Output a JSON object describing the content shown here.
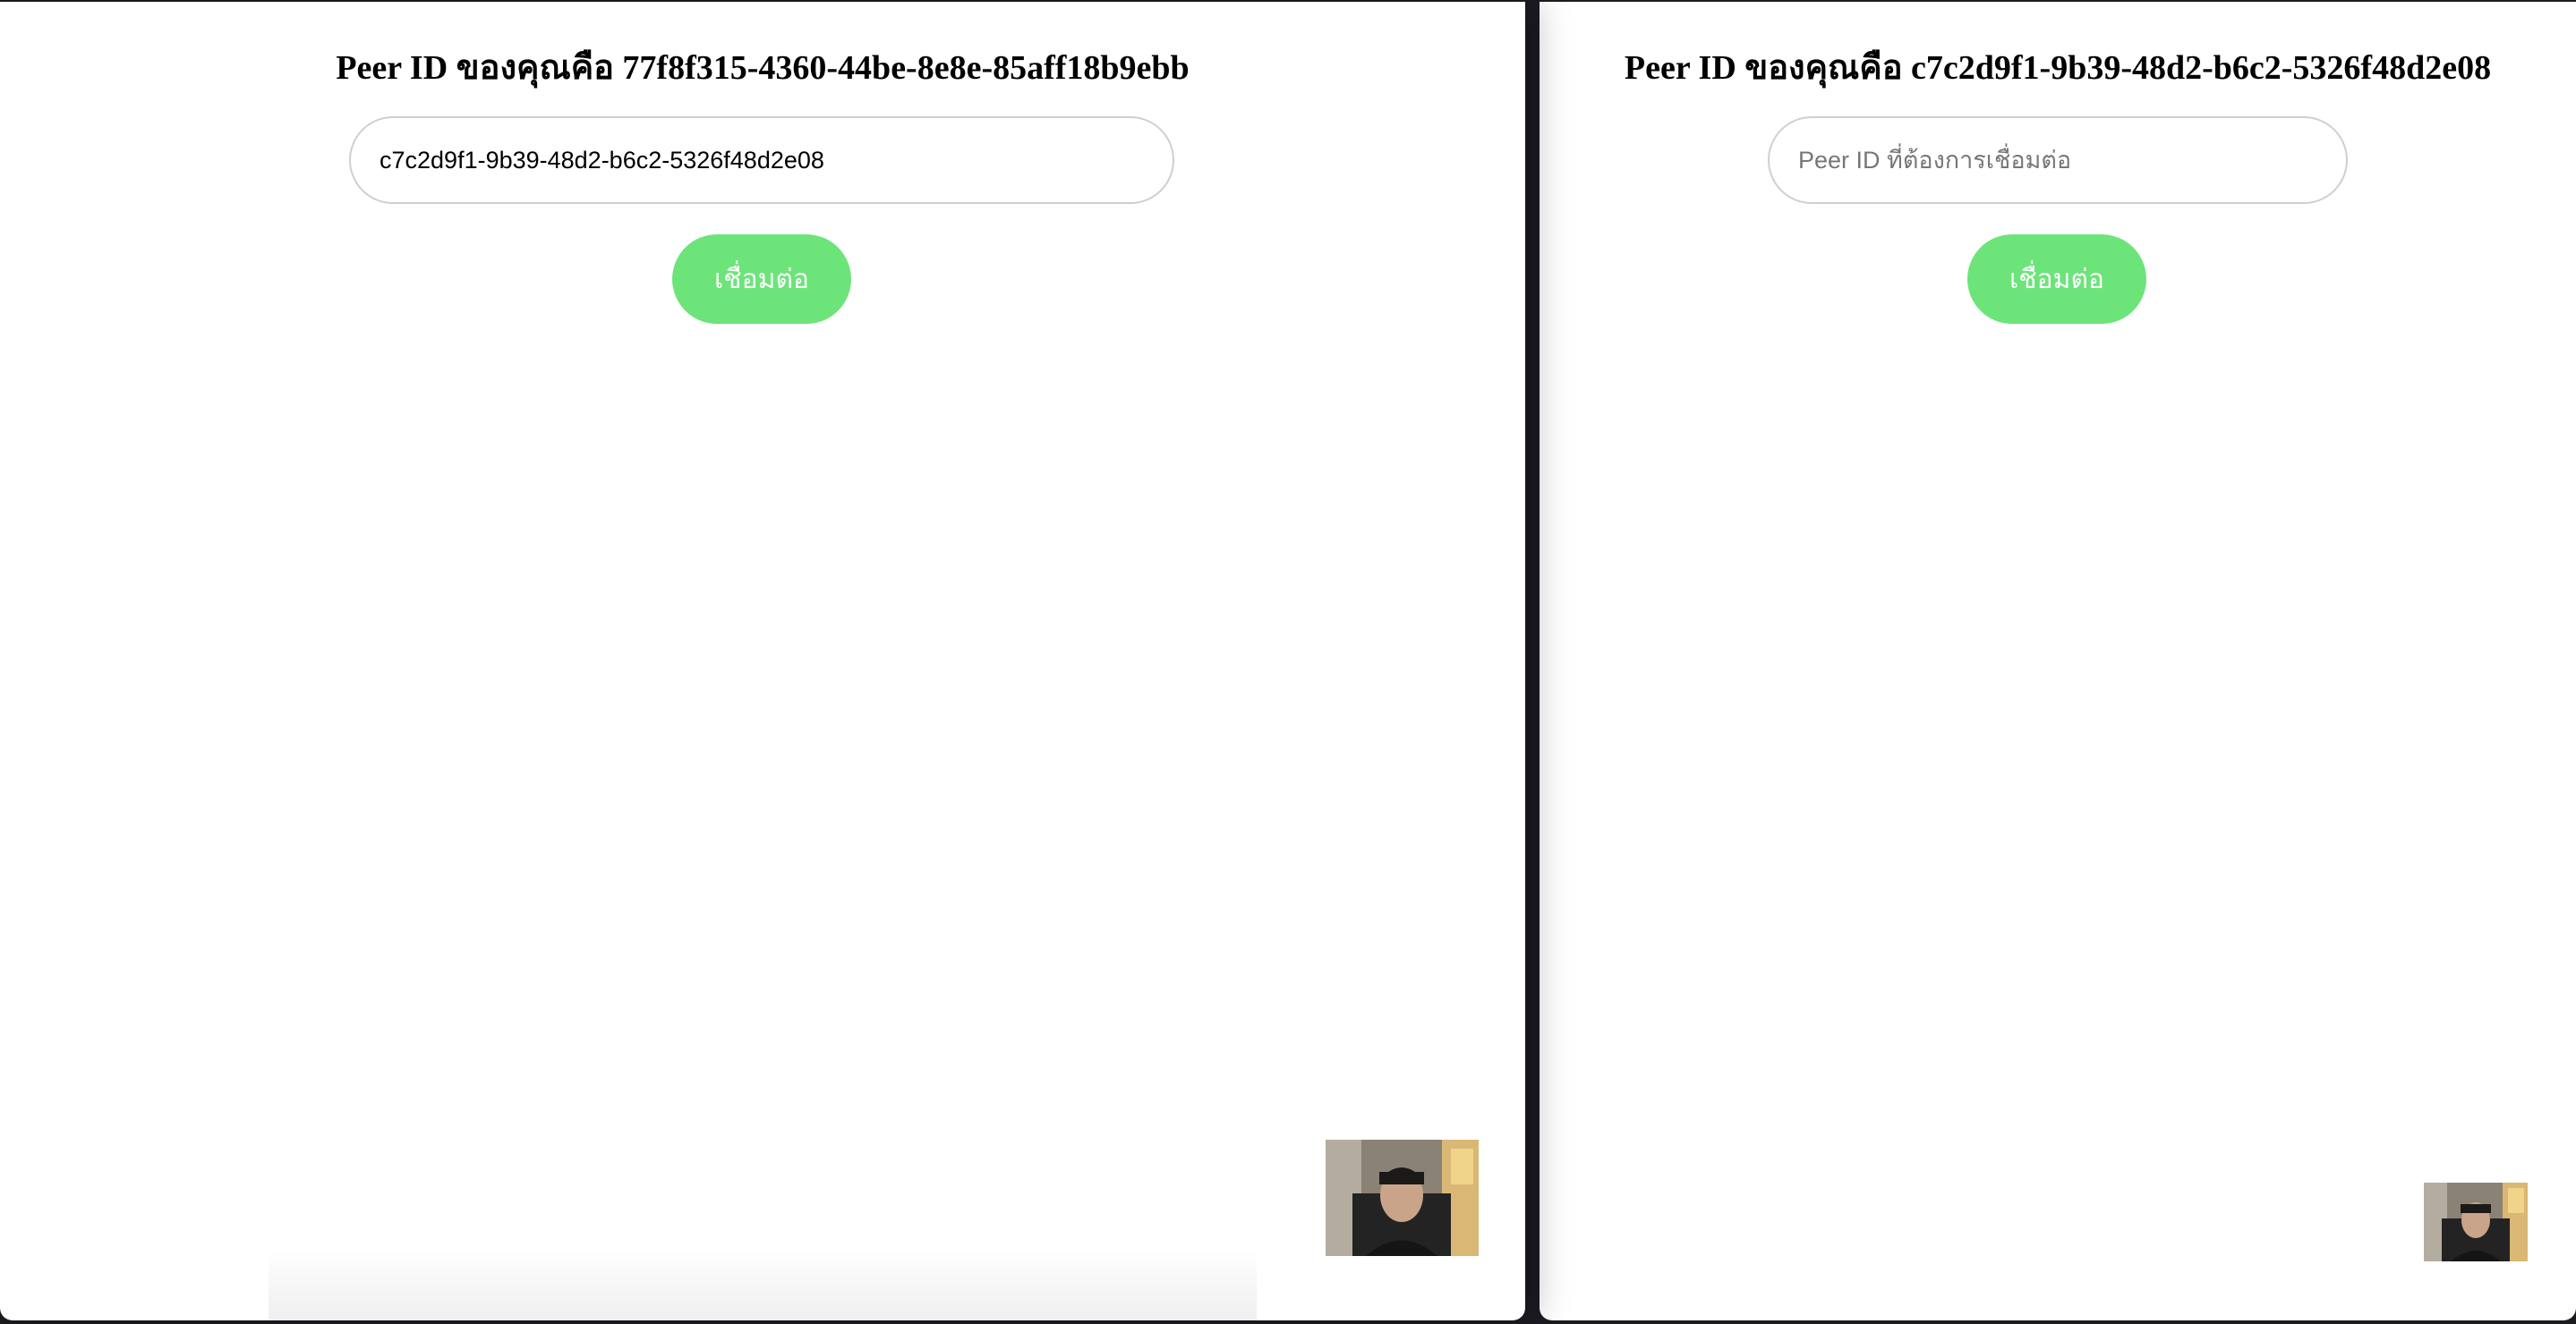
{
  "left_window": {
    "title": "Peer ID ของคุณคือ 77f8f315-4360-44be-8e8e-85aff18b9ebb",
    "input_value": "c7c2d9f1-9b39-48d2-b6c2-5326f48d2e08",
    "input_placeholder": "Peer ID ที่ต้องการเชื่อมต่อ",
    "connect_label": "เชื่อมต่อ"
  },
  "right_window": {
    "title": "Peer ID ของคุณคือ c7c2d9f1-9b39-48d2-b6c2-5326f48d2e08",
    "input_value": "",
    "input_placeholder": "Peer ID ที่ต้องการเชื่อมต่อ",
    "connect_label": "เชื่อมต่อ"
  },
  "colors": {
    "connect_button": "#6ce47a",
    "desktop_background": "#1c1b22"
  },
  "icons": {
    "local_video": "webcam-preview"
  }
}
